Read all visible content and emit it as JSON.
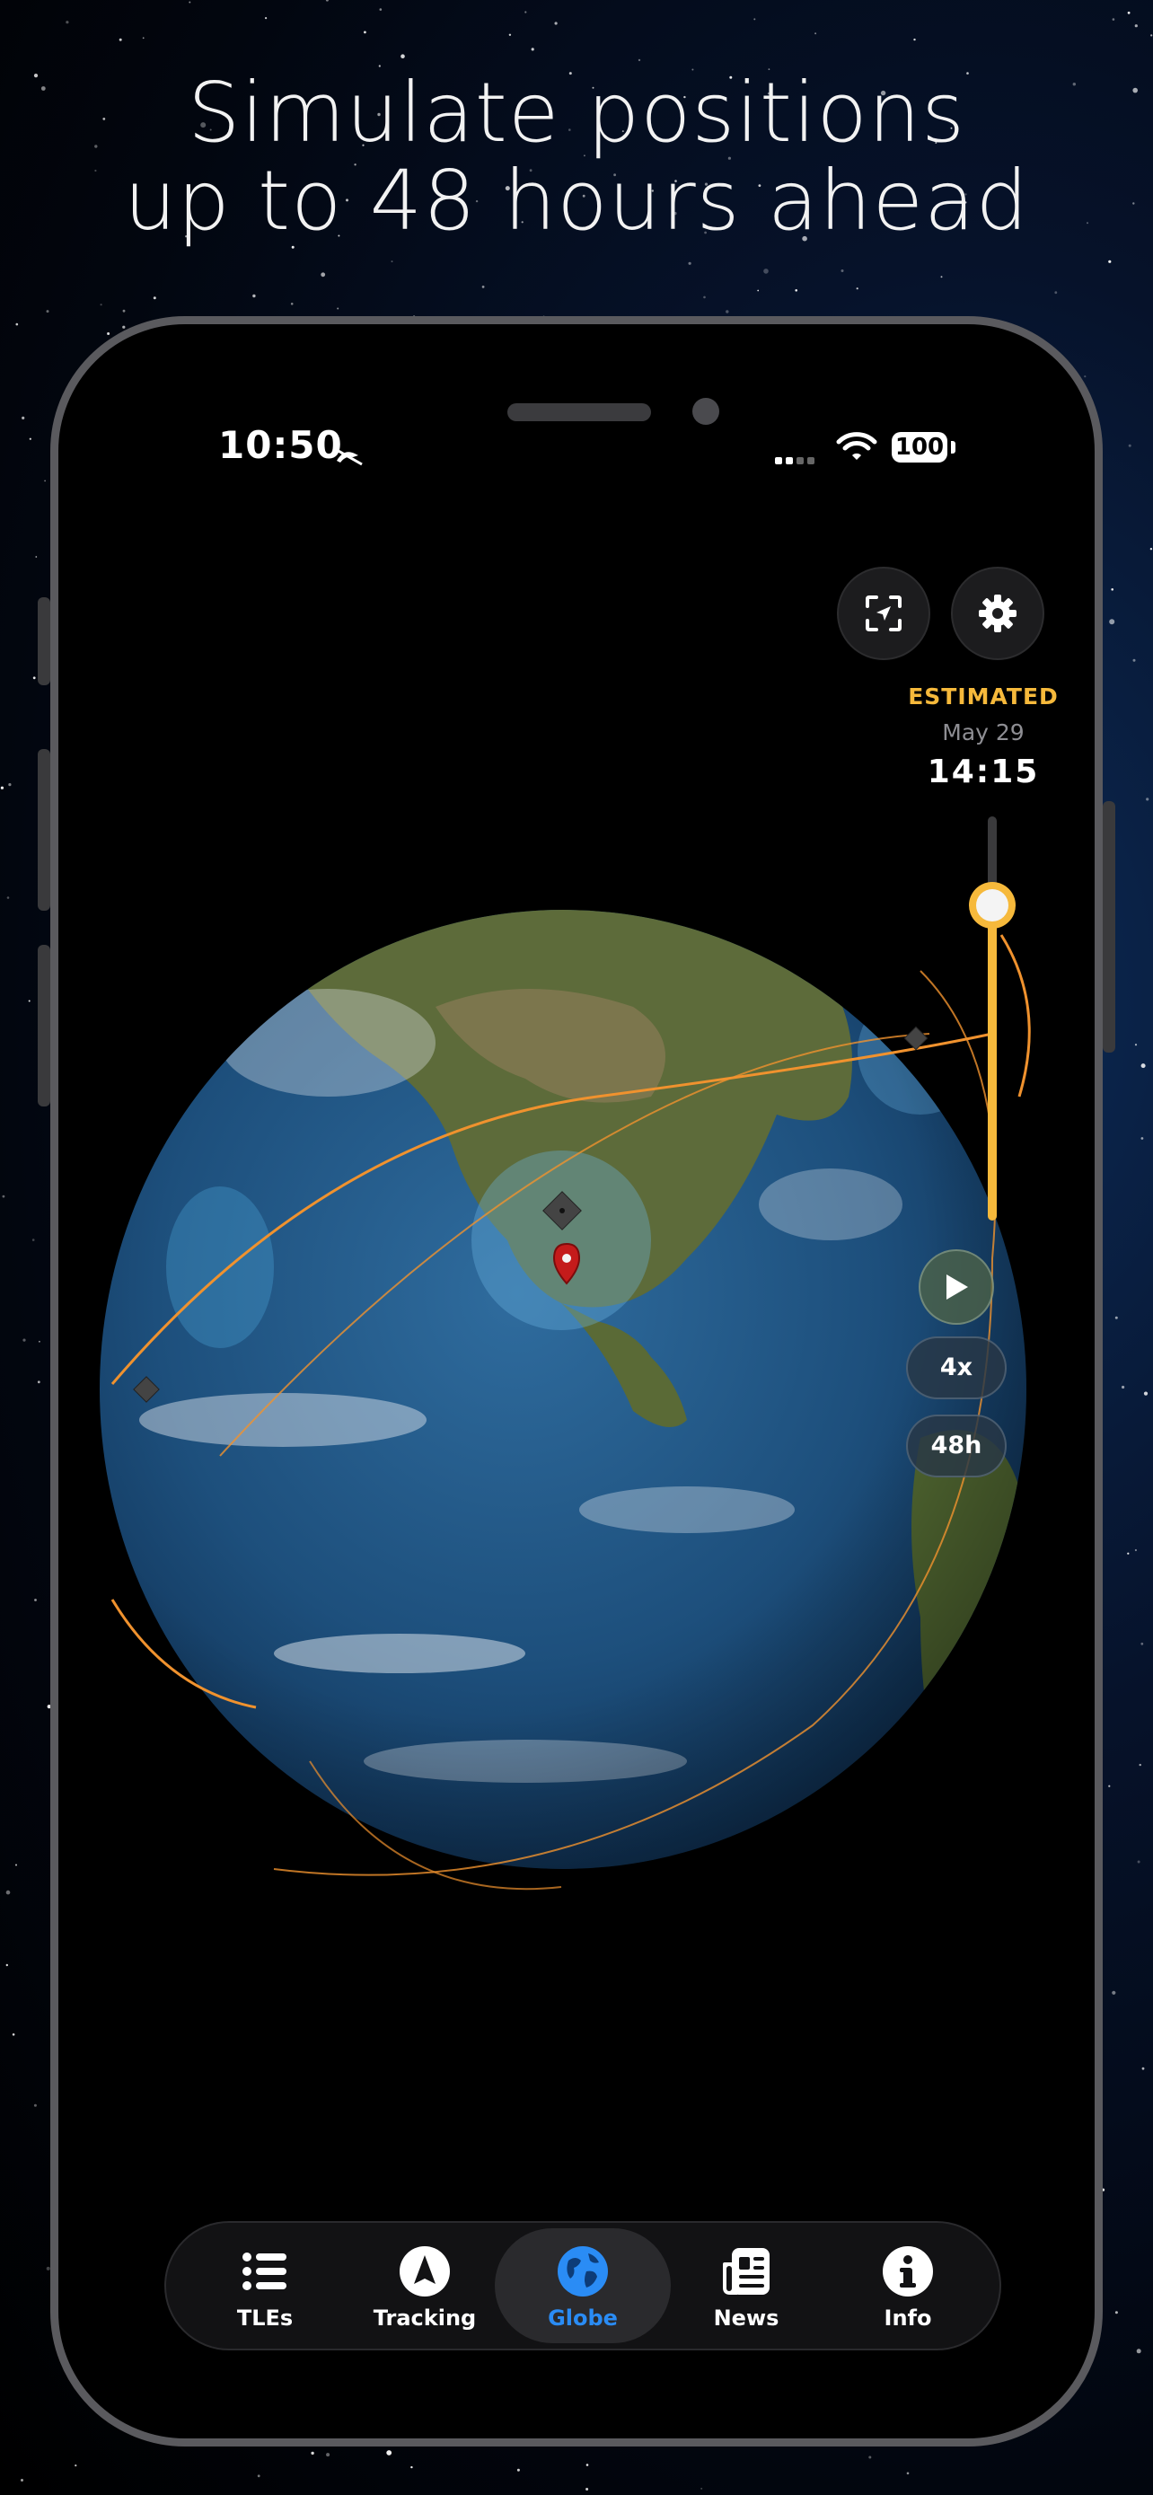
{
  "headline": {
    "line1": "Simulate positions",
    "line2": "up to 48 hours ahead"
  },
  "status_bar": {
    "time": "10:50",
    "battery": "100"
  },
  "top_controls": {
    "recenter_icon": "satellite-focus-icon",
    "settings_icon": "gear-icon"
  },
  "simulation": {
    "mode_label": "ESTIMATED",
    "date": "May 29",
    "time": "14:15",
    "time_slider_value": 0.78,
    "speed": "4x",
    "range": "48h"
  },
  "tabs": [
    {
      "label": "TLEs",
      "icon": "list-icon",
      "active": false
    },
    {
      "label": "Tracking",
      "icon": "navigation-arrow-icon",
      "active": false
    },
    {
      "label": "Globe",
      "icon": "globe-icon",
      "active": true
    },
    {
      "label": "News",
      "icon": "newspaper-icon",
      "active": false
    },
    {
      "label": "Info",
      "icon": "info-icon",
      "active": false
    }
  ],
  "colors": {
    "accent_estimated": "#f6b93b",
    "orbit": "#f0922e",
    "active_tab": "#2a8cf5"
  }
}
